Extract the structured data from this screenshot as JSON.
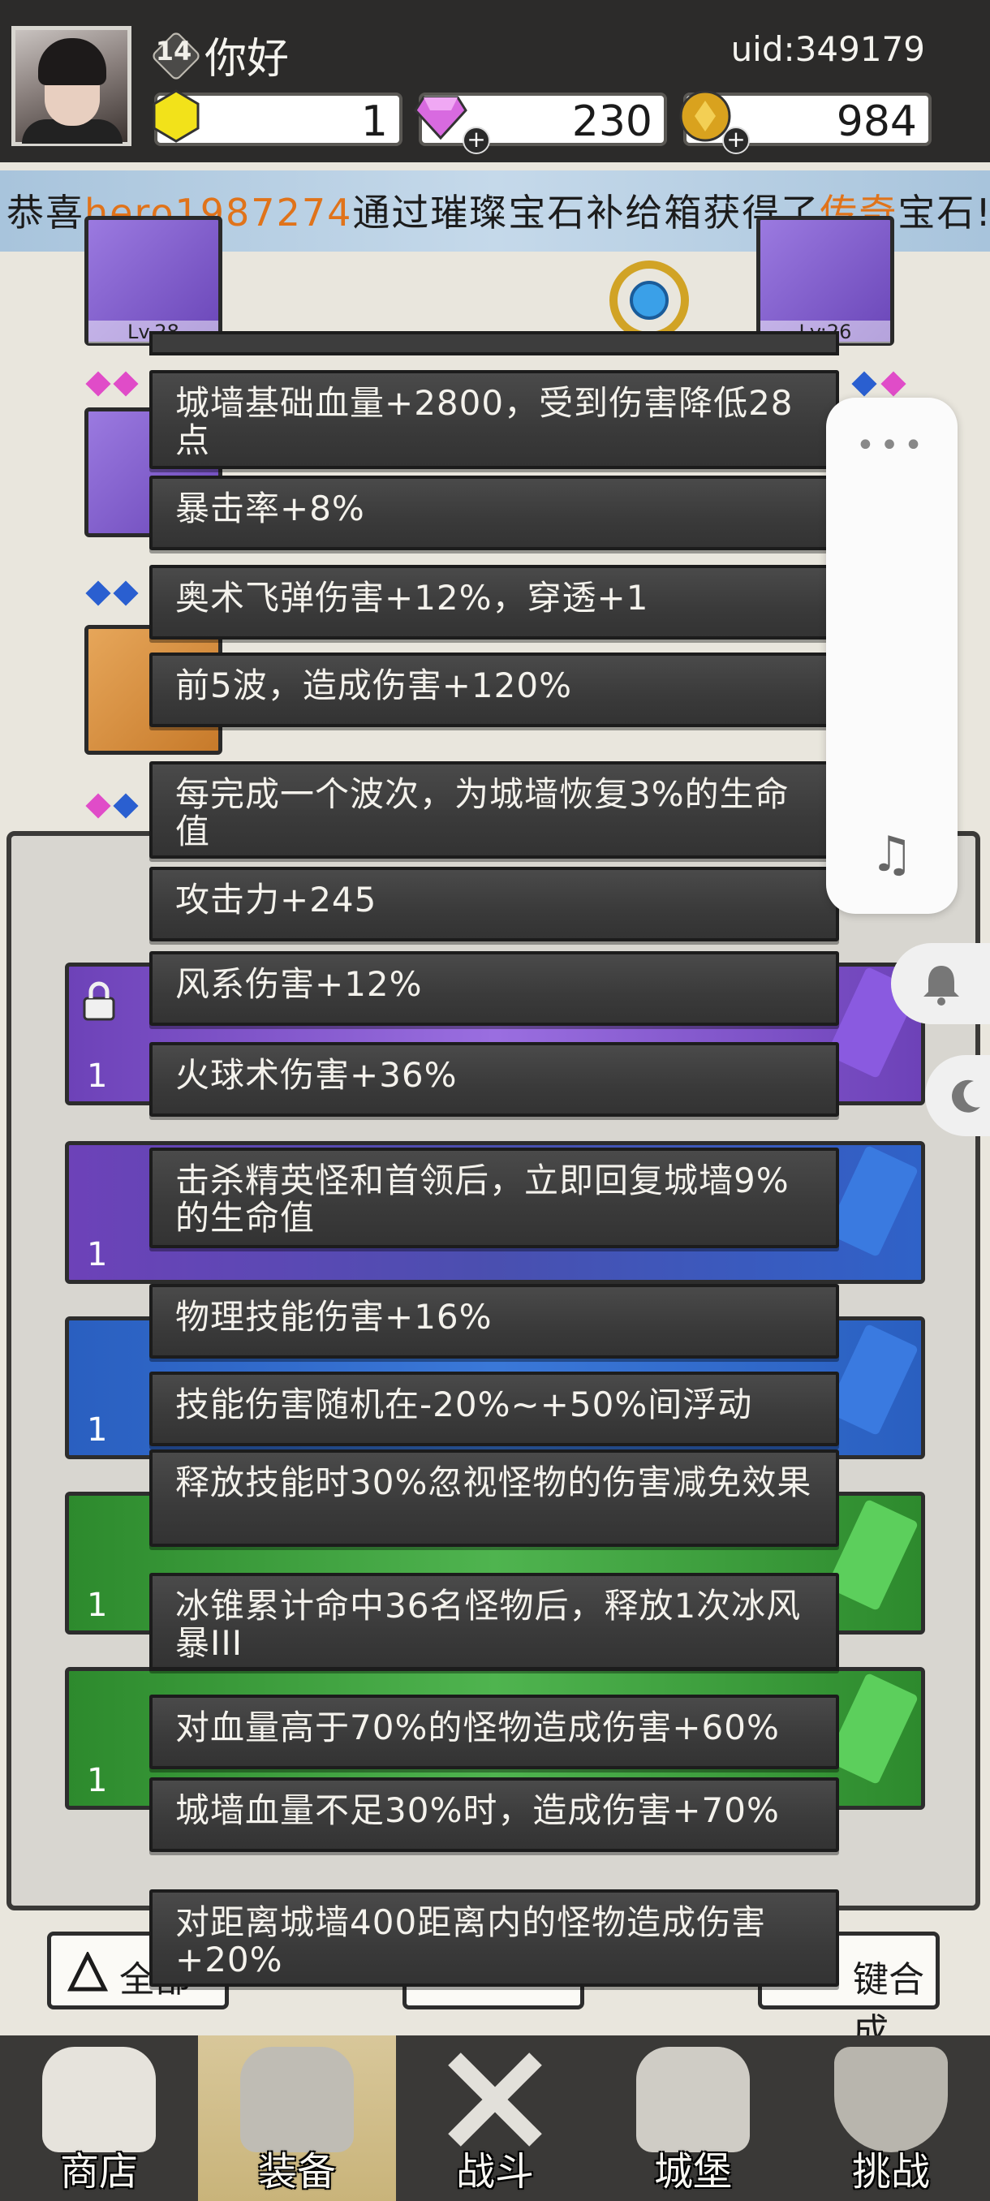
{
  "player": {
    "level": "14",
    "name": "你好",
    "uid": "uid:349179"
  },
  "resources": {
    "gold_crystal": "1",
    "diamond": "230",
    "coin": "984"
  },
  "ticker": {
    "prefix": "恭喜",
    "player": "hero1987274",
    "middle": "通过璀璨宝石补给箱获得了",
    "rarity": "传奇",
    "suffix": "宝石!"
  },
  "equipment": {
    "slot_left_top_level": "Lv.28",
    "slot_right_top_level": "Lv:26"
  },
  "stats": [
    "城墙基础血量+2800，受到伤害降低28点",
    "暴击率+8%",
    "奥术飞弹伤害+12%，穿透+1",
    "前5波，造成伤害+120%",
    "每完成一个波次，为城墙恢复3%的生命值",
    "攻击力+245",
    "风系伤害+12%",
    "火球术伤害+36%",
    "击杀精英怪和首领后，立即回复城墙9%的生命值",
    "物理技能伤害+16%",
    "技能伤害随机在-20%~+50%间浮动",
    "释放技能时30%忽视怪物的伤害减免效果",
    "冰锥累计命中36名怪物后，释放1次冰风暴III",
    "对血量高于70%的怪物造成伤害+60%",
    "城墙血量不足30%时，造成伤害+70%",
    "对距离城墙400距离内的怪物造成伤害+20%"
  ],
  "inventory_counts": [
    "1",
    "1",
    "1",
    "1",
    "1"
  ],
  "bottom_buttons": {
    "all": "全部",
    "merge": "键合成"
  },
  "nav": [
    "商店",
    "装备",
    "战斗",
    "城堡",
    "挑战"
  ],
  "side_menu": {
    "more": "•••",
    "music": "♫"
  },
  "colors": {
    "ticker_highlight": "#e0731a",
    "stat_bg": "#3a3a3a",
    "nav_active": "#c9b47a"
  }
}
